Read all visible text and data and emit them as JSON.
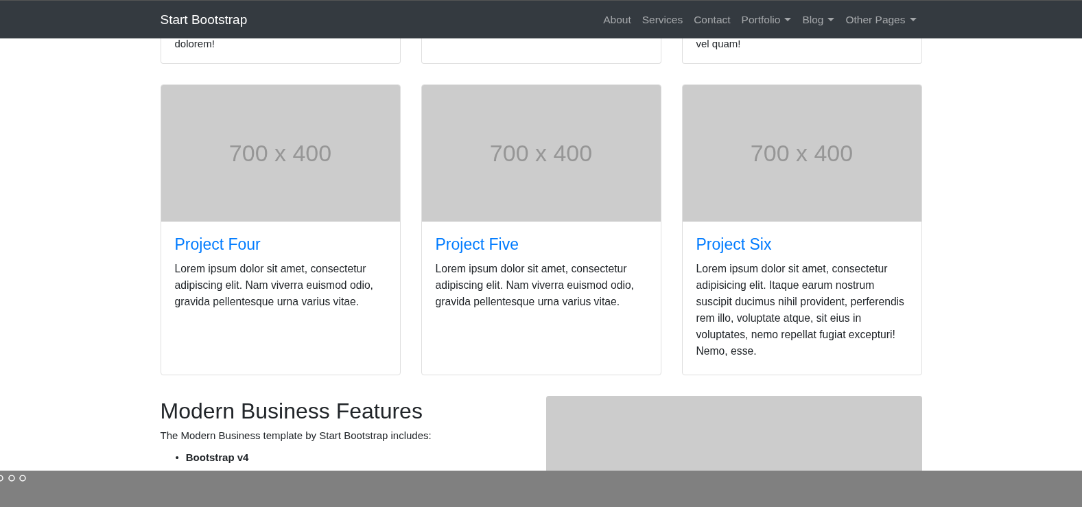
{
  "navbar": {
    "brand": "Start Bootstrap",
    "items": [
      {
        "label": "About",
        "dropdown": false
      },
      {
        "label": "Services",
        "dropdown": false
      },
      {
        "label": "Contact",
        "dropdown": false
      },
      {
        "label": "Portfolio",
        "dropdown": true
      },
      {
        "label": "Blog",
        "dropdown": true
      },
      {
        "label": "Other Pages",
        "dropdown": true
      }
    ]
  },
  "partial_cards": [
    {
      "kind": "text",
      "text": "dolorem!"
    },
    {
      "kind": "empty"
    },
    {
      "kind": "text",
      "text": "vel quam!"
    }
  ],
  "projects": [
    {
      "image_label": "700 x 400",
      "title": "Project Four",
      "text": "Lorem ipsum dolor sit amet, consectetur adipiscing elit. Nam viverra euismod odio, gravida pellentesque urna varius vitae."
    },
    {
      "image_label": "700 x 400",
      "title": "Project Five",
      "text": "Lorem ipsum dolor sit amet, consectetur adipiscing elit. Nam viverra euismod odio, gravida pellentesque urna varius vitae."
    },
    {
      "image_label": "700 x 400",
      "title": "Project Six",
      "text": "Lorem ipsum dolor sit amet, consectetur adipisicing elit. Itaque earum nostrum suscipit ducimus nihil provident, perferendis rem illo, voluptate atque, sit eius in voluptates, nemo repellat fugiat excepturi! Nemo, esse."
    }
  ],
  "features": {
    "heading": "Modern Business Features",
    "intro": "The Modern Business template by Start Bootstrap includes:",
    "list": [
      {
        "marker": "•",
        "text": "**Bootstrap v4**"
      }
    ]
  }
}
